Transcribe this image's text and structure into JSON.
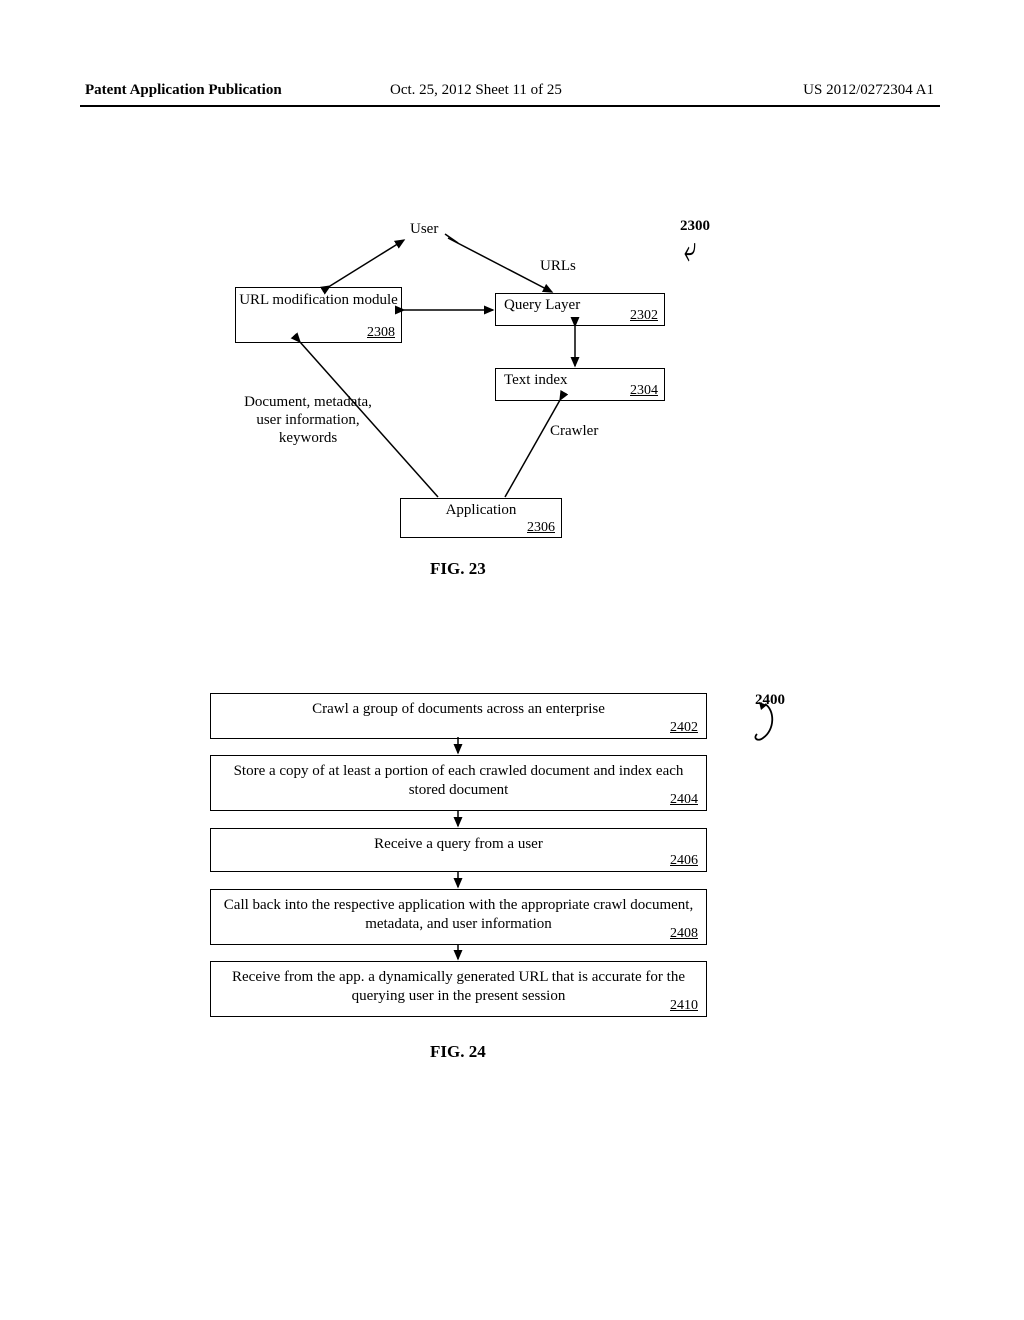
{
  "header": {
    "left": "Patent Application Publication",
    "mid": "Oct. 25, 2012  Sheet 11 of 25",
    "right": "US 2012/0272304 A1"
  },
  "fig23": {
    "label": "FIG. 23",
    "tag": "2300",
    "nodes": {
      "user": "User",
      "urls": "URLs",
      "url_mod": "URL modification module",
      "url_mod_ref": "2308",
      "query_layer": "Query Layer",
      "query_layer_ref": "2302",
      "text_index": "Text index",
      "text_index_ref": "2304",
      "crawler": "Crawler",
      "meta": "Document, metadata, user information, keywords",
      "application": "Application",
      "application_ref": "2306"
    }
  },
  "fig24": {
    "label": "FIG. 24",
    "tag": "2400",
    "steps": [
      {
        "text": "Crawl a group of documents across an enterprise",
        "ref": "2402"
      },
      {
        "text": "Store a copy of at least a portion of each crawled document and index each stored document",
        "ref": "2404"
      },
      {
        "text": "Receive a query from a user",
        "ref": "2406"
      },
      {
        "text": "Call back into the respective application with the appropriate crawl document, metadata, and user information",
        "ref": "2408"
      },
      {
        "text": "Receive from the app. a dynamically generated URL that is accurate for the querying user in the present session",
        "ref": "2410"
      }
    ]
  }
}
